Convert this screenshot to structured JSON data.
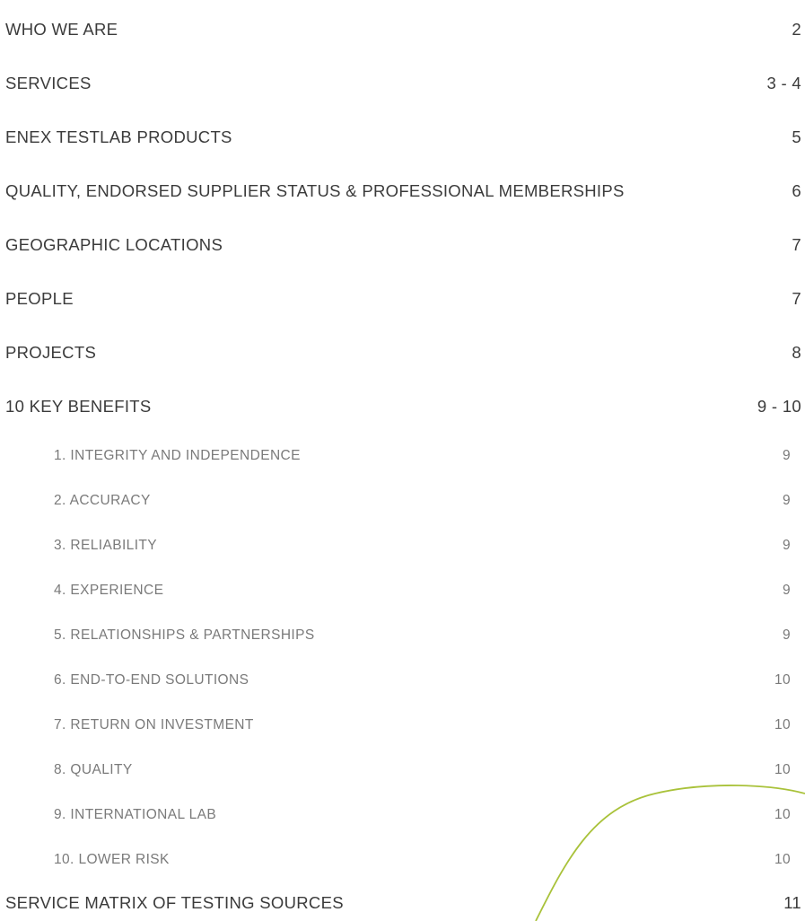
{
  "toc": {
    "entries": [
      {
        "title": "WHO WE ARE",
        "page": "2",
        "level": 1
      },
      {
        "title": "SERVICES",
        "page": "3 - 4",
        "level": 1
      },
      {
        "title": "ENEX TESTLAB PRODUCTS",
        "page": "5",
        "level": 1
      },
      {
        "title": "QUALITY, ENDORSED SUPPLIER STATUS & PROFESSIONAL MEMBERSHIPS",
        "page": "6",
        "level": 1
      },
      {
        "title": "GEOGRAPHIC LOCATIONS",
        "page": "7",
        "level": 1
      },
      {
        "title": "PEOPLE",
        "page": "7",
        "level": 1
      },
      {
        "title": "PROJECTS",
        "page": "8",
        "level": 1
      },
      {
        "title": "10 KEY BENEFITS",
        "page": "9 - 10",
        "level": 1
      },
      {
        "title": "1. INTEGRITY AND INDEPENDENCE",
        "page": "9",
        "level": 2
      },
      {
        "title": "2. ACCURACY",
        "page": "9",
        "level": 2
      },
      {
        "title": "3. RELIABILITY",
        "page": "9",
        "level": 2
      },
      {
        "title": "4. EXPERIENCE",
        "page": "9",
        "level": 2
      },
      {
        "title": "5. RELATIONSHIPS & PARTNERSHIPS",
        "page": "9",
        "level": 2
      },
      {
        "title": "6. END-TO-END SOLUTIONS",
        "page": "10",
        "level": 2
      },
      {
        "title": "7. RETURN ON INVESTMENT",
        "page": "10",
        "level": 2
      },
      {
        "title": "8. QUALITY",
        "page": "10",
        "level": 2
      },
      {
        "title": "9. INTERNATIONAL LAB",
        "page": "10",
        "level": 2
      },
      {
        "title": "10. LOWER RISK",
        "page": "10",
        "level": 2
      },
      {
        "title": "SERVICE MATRIX OF TESTING SOURCES",
        "page": "11",
        "level": 1
      }
    ]
  },
  "decoration": {
    "curve_color": "#a9c23a",
    "icon": "decorative-green-curve"
  }
}
